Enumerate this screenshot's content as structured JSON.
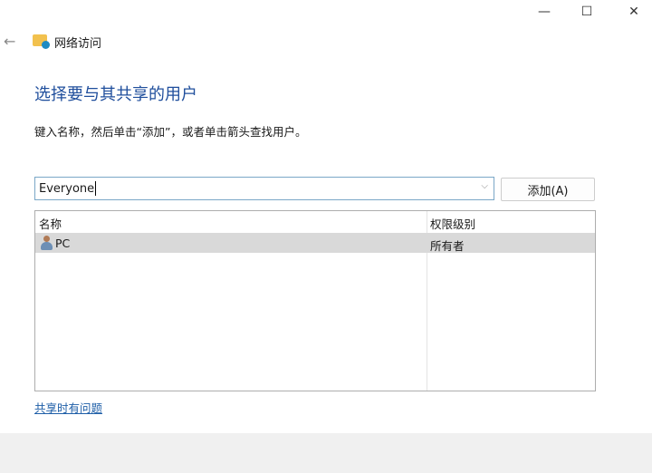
{
  "window": {
    "minimize": "—",
    "maximize": "☐",
    "close": "✕",
    "back": "←",
    "title": "网络访问"
  },
  "heading": "选择要与其共享的用户",
  "instruction": "键入名称，然后单击“添加”，或者单击箭头查找用户。",
  "combo": {
    "value": "Everyone",
    "chevron": "⌵"
  },
  "add_button": "添加(A)",
  "list": {
    "columns": [
      "名称",
      "权限级别"
    ],
    "rows": [
      {
        "name": "PC",
        "permission": "所有者"
      }
    ]
  },
  "help_link": "共享时有问题"
}
